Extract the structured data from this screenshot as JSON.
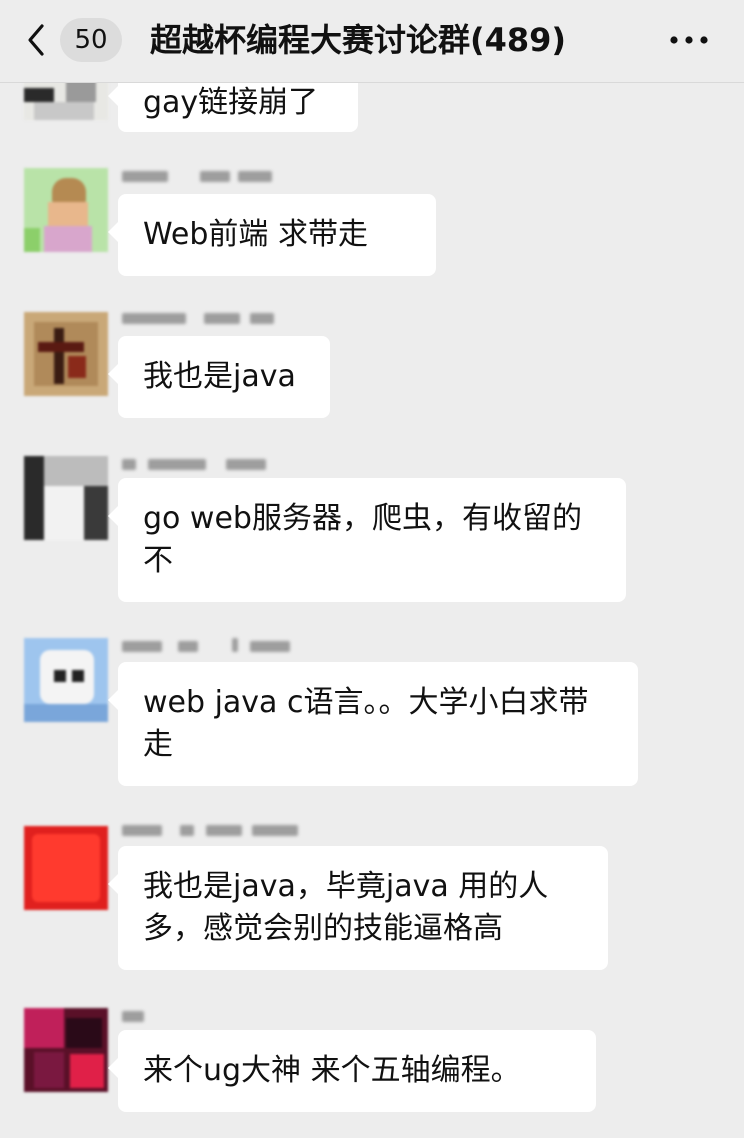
{
  "header": {
    "unread_count": "50",
    "title": "超越杯编程大赛讨论群(489)"
  },
  "messages": [
    {
      "text": "gay链接崩了"
    },
    {
      "text": "Web前端   求带走"
    },
    {
      "text": "我也是java"
    },
    {
      "text": "go web服务器，爬虫，有收留的不"
    },
    {
      "text": "web java c语言。。大学小白求带走"
    },
    {
      "text": "我也是java，毕竟java 用的人多，感觉会别的技能逼格高"
    },
    {
      "text": "来个ug大神 来个五轴编程。"
    }
  ]
}
